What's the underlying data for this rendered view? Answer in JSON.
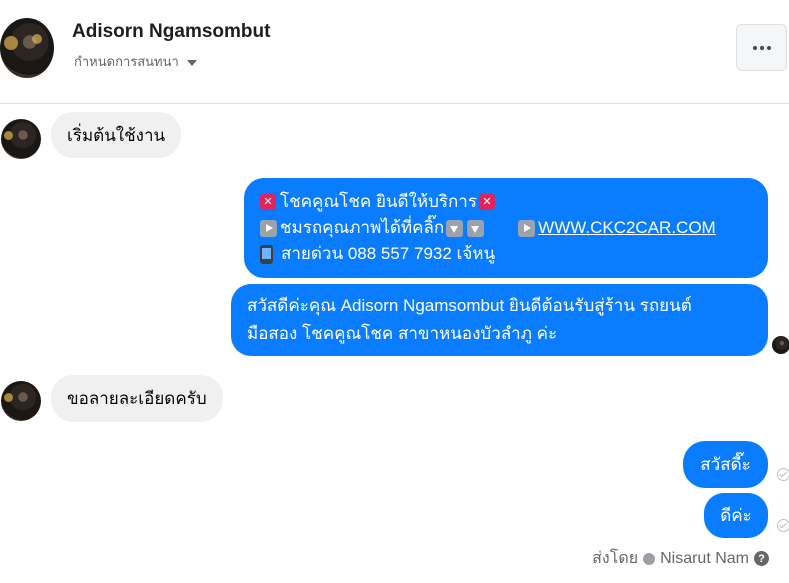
{
  "header": {
    "contact_name": "Adisorn Ngamsombut",
    "subtitle": "กำหนดการสนทนา",
    "more_glyph": "···"
  },
  "messages": [
    {
      "side": "incoming",
      "text": "เริ่มต้นใช้งาน"
    },
    {
      "side": "outgoing",
      "type": "card",
      "line1": "โชคคูณโชค ยินดีให้บริการ",
      "line2_text": "ชมรถคุณภาพได้ที่คลิ๊ก",
      "line2_link": "WWW.CKC2CAR.COM",
      "line3": "สายด่วน 088 557 7932 เจ้หนู"
    },
    {
      "side": "outgoing",
      "text": "สวัสดีค่ะคุณ Adisorn Ngamsombut ยินดีต้อนรับสู่ร้าน รถยนต์มือสอง โชคคูณโชค สาขาหนองบัวลำภู ค่ะ",
      "line1": "สวัสดีค่ะคุณ Adisorn Ngamsombut ยินดีต้อนรับสู่ร้าน รถยนต์",
      "line2": "มือสอง โชคคูณโชค สาขาหนองบัวลำภู ค่ะ"
    },
    {
      "side": "incoming",
      "text": "ขอลายละเอียดครับ"
    },
    {
      "side": "outgoing",
      "text": "สวัสดี๊ะ"
    },
    {
      "side": "outgoing",
      "text": "ดีค่ะ"
    }
  ],
  "footer": {
    "sent_by_label": "ส่งโดย",
    "sender_name": "Nisarut Nam",
    "help_glyph": "?"
  },
  "colors": {
    "outgoing_bubble": "#0a7cff",
    "incoming_bubble": "#f0f0f0"
  },
  "icons": [
    "more-icon",
    "dropdown-caret-icon",
    "red-x-emoji-icon",
    "play-emoji-icon",
    "down-arrow-emoji-icon",
    "mobile-phone-emoji-icon",
    "read-receipt-icon",
    "verified-check-icon",
    "help-icon"
  ]
}
